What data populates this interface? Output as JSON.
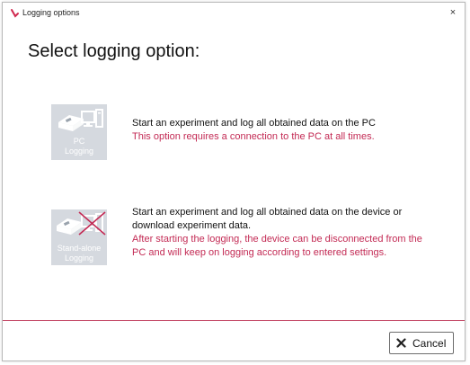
{
  "window": {
    "title": "Logging options",
    "close_glyph": "×"
  },
  "main": {
    "heading": "Select logging option:"
  },
  "options": [
    {
      "icon": "device-and-pc-icon",
      "tile_label_line1": "PC",
      "tile_label_line2": "Logging",
      "description": "Start an experiment and log all obtained data on the PC",
      "note": "This option requires a connection to the PC at all times."
    },
    {
      "icon": "device-no-pc-icon",
      "tile_label_line1": "Stand-alone",
      "tile_label_line2": "Logging",
      "description": "Start an experiment and log all obtained data on the device or download experiment data.",
      "note": "After starting the logging, the device can be disconnected from the PC and will keep on logging according to entered settings."
    }
  ],
  "footer": {
    "cancel_label": "Cancel"
  },
  "colors": {
    "accent": "#c32a54",
    "divider": "#c64f6c",
    "tile_bg": "#d5d9df"
  }
}
